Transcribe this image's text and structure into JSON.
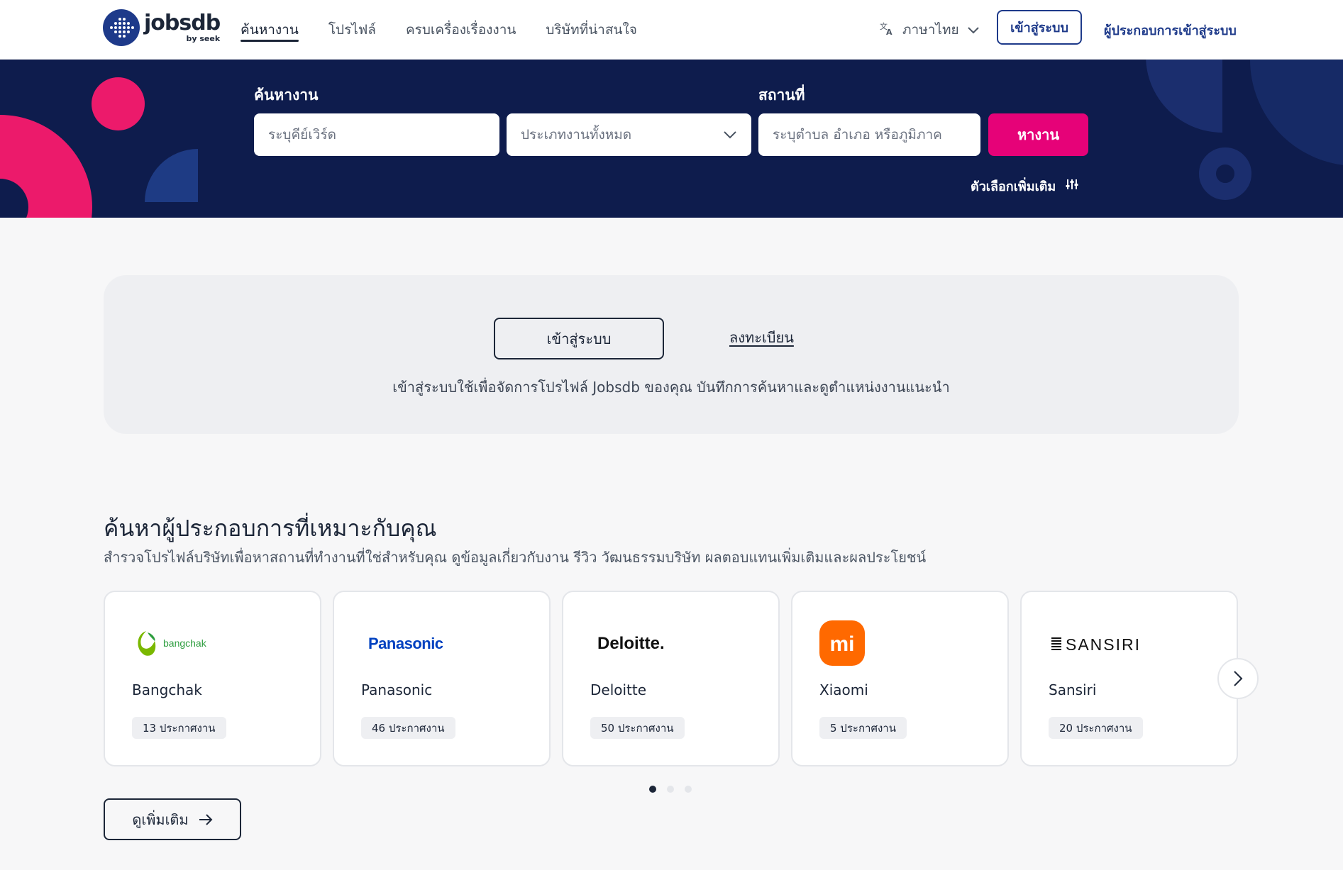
{
  "header": {
    "logo_word": "jobsdb",
    "logo_by": "by seek",
    "nav": [
      {
        "label": "ค้นหางาน",
        "active": true
      },
      {
        "label": "โปรไฟล์",
        "active": false
      },
      {
        "label": "ครบเครื่องเรื่องงาน",
        "active": false
      },
      {
        "label": "บริษัทที่น่าสนใจ",
        "active": false
      }
    ],
    "language_label": "ภาษาไทย",
    "login_label": "เข้าสู่ระบบ",
    "employer_label": "ผู้ประกอบการเข้าสู่ระบบ"
  },
  "search": {
    "job_label": "ค้นหางาน",
    "location_label": "สถานที่",
    "keyword_placeholder": "ระบุคีย์เวิร์ด",
    "category_value": "ประเภทงานทั้งหมด",
    "location_placeholder": "ระบุตำบล อำเภอ หรือภูมิภาค",
    "search_button": "หางาน",
    "more_options": "ตัวเลือกเพิ่มเติม"
  },
  "signin_panel": {
    "signin_button": "เข้าสู่ระบบ",
    "register_link": "ลงทะเบียน",
    "description": "เข้าสู่ระบบใช้เพื่อจัดการโปรไฟล์ Jobsdb ของคุณ บันทึกการค้นหาและดูตำแหน่งงานแนะนำ"
  },
  "companies": {
    "title": "ค้นหาผู้ประกอบการที่เหมาะกับคุณ",
    "subtitle": "สำรวจโปรไฟล์บริษัทเพื่อหาสถานที่ทำงานที่ใช่สำหรับคุณ ดูข้อมูลเกี่ยวกับงาน รีวิว วัฒนธรรมบริษัท ผลตอบแทนเพิ่มเติมและผลประโยชน์",
    "items": [
      {
        "name": "Bangchak",
        "jobs": "13 ประกาศงาน",
        "logo_text": "bangchak"
      },
      {
        "name": "Panasonic",
        "jobs": "46 ประกาศงาน",
        "logo_text": "Panasonic"
      },
      {
        "name": "Deloitte",
        "jobs": "50 ประกาศงาน",
        "logo_text": "Deloitte."
      },
      {
        "name": "Xiaomi",
        "jobs": "5 ประกาศงาน",
        "logo_text": "mi"
      },
      {
        "name": "Sansiri",
        "jobs": "20 ประกาศงาน",
        "logo_text": "SANSIRI"
      }
    ],
    "carousel_page": 1,
    "carousel_pages": 3,
    "see_more": "ดูเพิ่มเติม"
  },
  "colors": {
    "brand_navy": "#0e1c4d",
    "brand_pink": "#e60278",
    "link_blue": "#1e3a8a"
  }
}
